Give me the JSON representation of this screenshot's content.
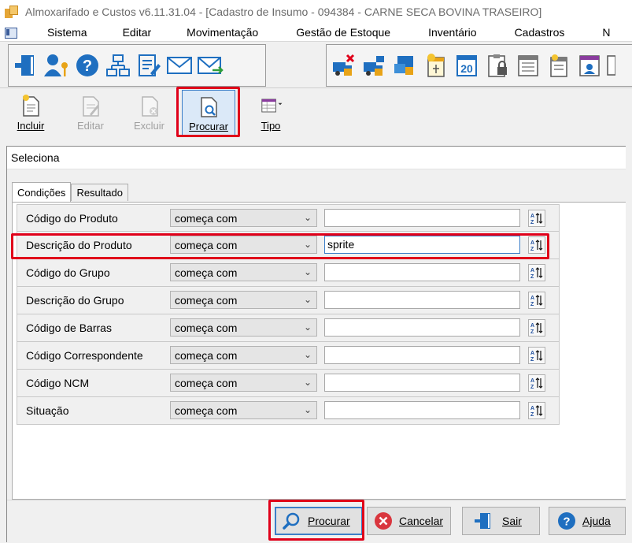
{
  "window": {
    "title": "Almoxarifado e Custos v6.11.31.04 - [Cadastro de Insumo - 094384 - CARNE SECA BOVINA TRASEIRO]"
  },
  "menu": {
    "items": [
      "Sistema",
      "Editar",
      "Movimentação",
      "Gestão de Estoque",
      "Inventário",
      "Cadastros",
      "N"
    ]
  },
  "toolbar": {
    "group1_icons": [
      "exit-door-icon",
      "user-key-icon",
      "help-icon",
      "org-chart-icon",
      "edit-form-icon",
      "email-icon",
      "email-send-icon"
    ],
    "group2_icons": [
      "truck-cancel-icon",
      "truck-box-icon",
      "transfer-icon",
      "calendar-star-icon",
      "calendar-20-icon",
      "clipboard-lock-icon",
      "calendar-grid-icon",
      "calendar-star-2-icon",
      "report-icon"
    ]
  },
  "actions": {
    "incluir": "Incluir",
    "editar": "Editar",
    "excluir": "Excluir",
    "procurar": "Procurar",
    "tipo": "Tipo"
  },
  "dialog": {
    "title": "Seleciona",
    "tabs": [
      "Condições",
      "Resultado"
    ],
    "rows": [
      {
        "field": "Código do Produto",
        "operator": "começa com",
        "value": ""
      },
      {
        "field": "Descrição do Produto",
        "operator": "começa com",
        "value": "sprite"
      },
      {
        "field": "Código do Grupo",
        "operator": "começa com",
        "value": ""
      },
      {
        "field": "Descrição do Grupo",
        "operator": "começa com",
        "value": ""
      },
      {
        "field": "Código de Barras",
        "operator": "começa com",
        "value": ""
      },
      {
        "field": "Código Correspondente",
        "operator": "começa com",
        "value": ""
      },
      {
        "field": "Código NCM",
        "operator": "começa com",
        "value": ""
      },
      {
        "field": "Situação",
        "operator": "começa com",
        "value": ""
      }
    ],
    "buttons": {
      "procurar": "Procurar",
      "cancelar": "Cancelar",
      "sair": "Sair",
      "ajuda": "Ajuda"
    }
  },
  "colors": {
    "highlight": "#e0001a",
    "accent_blue": "#1f6fc0"
  }
}
